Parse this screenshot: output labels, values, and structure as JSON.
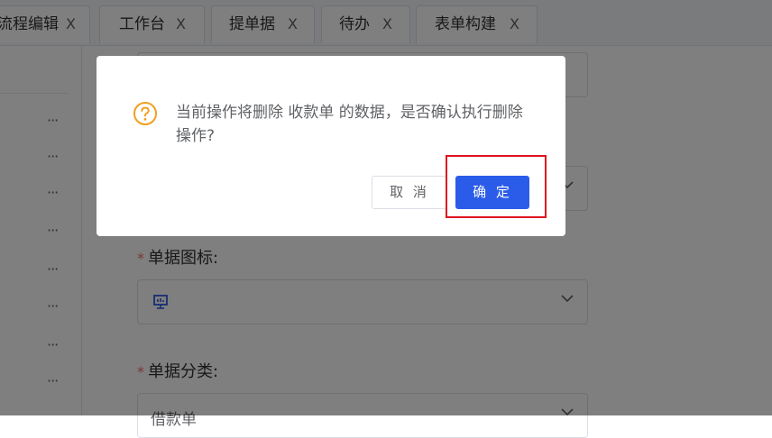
{
  "tabs": [
    {
      "label": "流程编辑",
      "close": "X"
    },
    {
      "label": "工作台",
      "close": "X"
    },
    {
      "label": "提单据",
      "close": "X"
    },
    {
      "label": "待办",
      "close": "X"
    },
    {
      "label": "表单构建",
      "close": "X"
    }
  ],
  "sidebar": {
    "more": "···"
  },
  "form": {
    "icon_label": "单据图标:",
    "category_label": "单据分类:",
    "category_value": "借款单",
    "required_mark": "*"
  },
  "dialog": {
    "icon": "question-circle-icon",
    "message": "当前操作将删除 收款单 的数据，是否确认执行删除操作?",
    "cancel_label": "取 消",
    "confirm_label": "确 定"
  },
  "colors": {
    "primary": "#2b5ce9",
    "warning": "#f0a020",
    "highlight": "#e0141e",
    "required": "#f56c6c"
  }
}
